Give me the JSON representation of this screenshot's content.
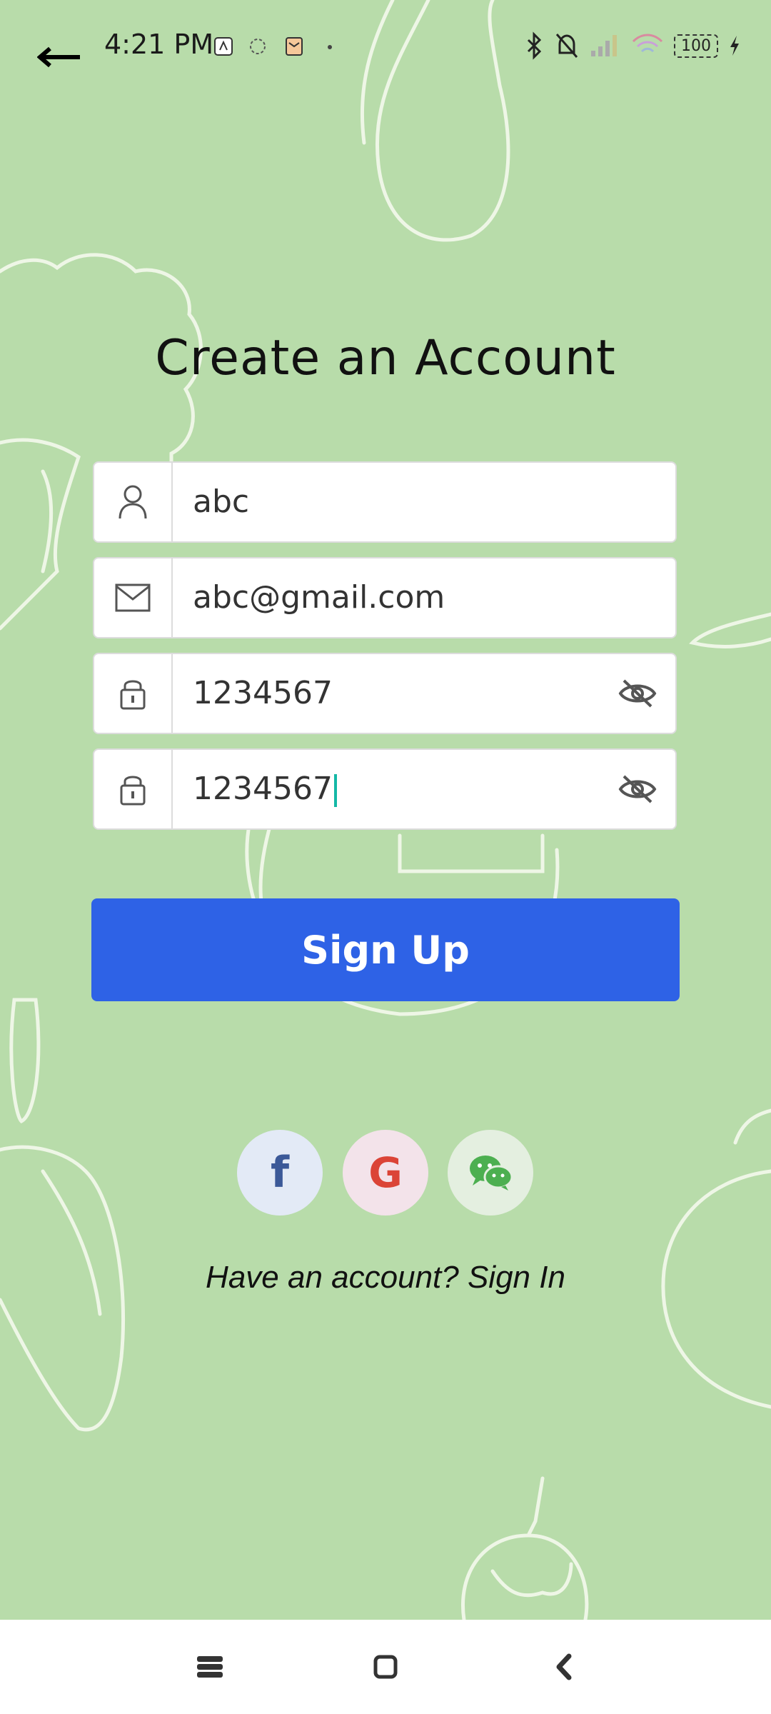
{
  "status_bar": {
    "time": "4:21 PM",
    "battery": "100",
    "icons": [
      "bluetooth-icon",
      "bell-off-icon",
      "signal-icon",
      "wifi-icon",
      "battery-icon",
      "charging-icon"
    ]
  },
  "header": {
    "back_icon": "back-arrow-icon"
  },
  "title": "Create an Account",
  "form": {
    "username": {
      "value": "abc",
      "icon": "person-icon"
    },
    "email": {
      "value": "abc@gmail.com",
      "icon": "mail-icon"
    },
    "password": {
      "value": "1234567",
      "icon": "lock-icon",
      "toggle_icon": "eye-off-icon"
    },
    "confirm_password": {
      "value": "1234567",
      "icon": "lock-icon",
      "toggle_icon": "eye-off-icon"
    }
  },
  "signup_button": {
    "label": "Sign Up",
    "color": "#2e62e6"
  },
  "social": [
    {
      "name": "facebook",
      "glyph": "f",
      "color": "#3b5998"
    },
    {
      "name": "google",
      "glyph": "G",
      "color": "#db4437"
    },
    {
      "name": "wechat",
      "glyph": "",
      "color": "#4caf50"
    }
  ],
  "signin_link": "Have an account? Sign In",
  "colors": {
    "background": "#b8dcaa",
    "accent": "#2e62e6",
    "caret": "#14b8a6"
  },
  "nav_bar": {
    "icons": [
      "menu-icon",
      "home-icon",
      "back-icon"
    ]
  }
}
